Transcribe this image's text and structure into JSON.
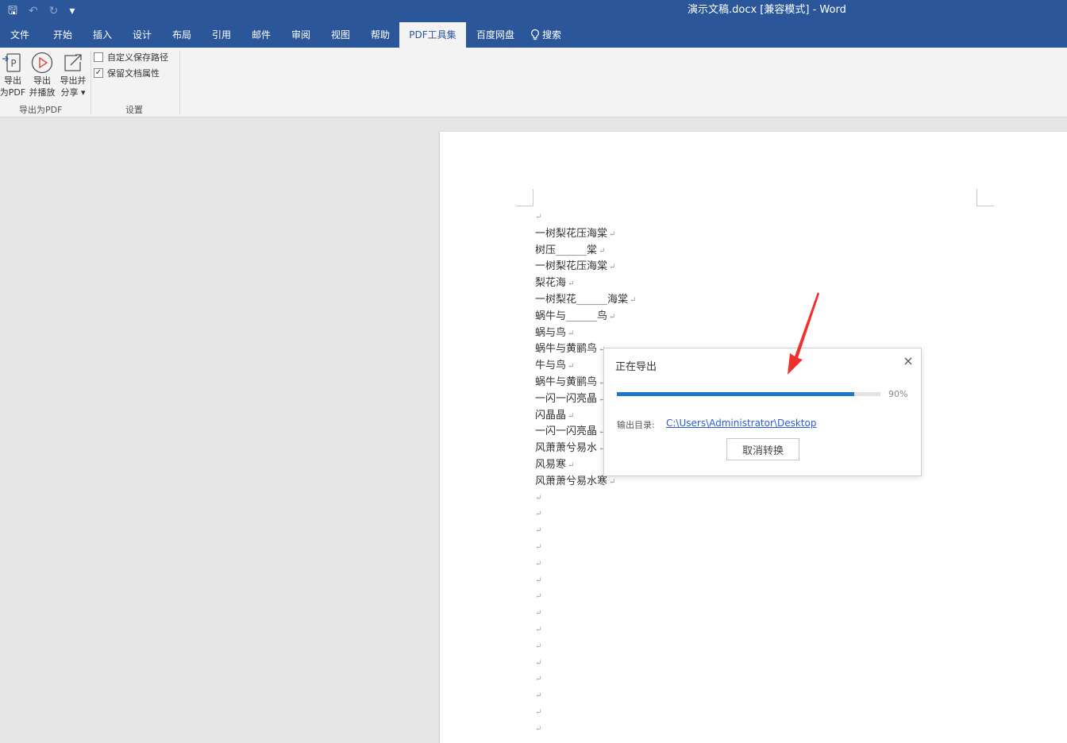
{
  "window": {
    "title": "演示文稿.docx [兼容模式] - Word",
    "qat": {
      "save_glyph": "🖫",
      "undo_glyph": "↶",
      "redo_glyph": "↻",
      "customize_glyph": "▾"
    }
  },
  "ribbon_tabs": [
    {
      "label": "文件"
    },
    {
      "label": "开始"
    },
    {
      "label": "插入"
    },
    {
      "label": "设计"
    },
    {
      "label": "布局"
    },
    {
      "label": "引用"
    },
    {
      "label": "邮件"
    },
    {
      "label": "审阅"
    },
    {
      "label": "视图"
    },
    {
      "label": "帮助"
    },
    {
      "label": "PDF工具集"
    },
    {
      "label": "百度网盘"
    }
  ],
  "search_tab": {
    "label": "搜索"
  },
  "ribbon": {
    "export_pdf": {
      "line1": "导出",
      "line2": "为PDF"
    },
    "export_play": {
      "line1": "导出",
      "line2": "并播放"
    },
    "export_share": {
      "line1": "导出并",
      "line2": "分享 ▾"
    },
    "group_export_label": "导出为PDF",
    "custom_path": {
      "label": "自定义保存路径",
      "checked": false
    },
    "keep_props": {
      "label": "保留文档属性",
      "checked": true,
      "check_glyph": "✓"
    },
    "group_settings_label": "设置"
  },
  "document": {
    "lines": [
      "一树梨花压海棠",
      "树压______棠",
      "一树梨花压海棠",
      "梨花海",
      "一树梨花______海棠",
      "蜗牛与______鸟",
      "蜗与鸟",
      "蜗牛与黄鹂鸟",
      "牛与鸟",
      "蜗牛与黄鹂鸟",
      "一闪一闪亮晶",
      "闪晶晶",
      "一闪一闪亮晶",
      "风萧萧兮易水",
      "风易寒",
      "风萧萧兮易水寒"
    ],
    "paragraph_mark": "↵"
  },
  "dialog": {
    "title": "正在导出",
    "close_glyph": "×",
    "progress_value": 0.9,
    "progress_text": "90%",
    "output_label": "输出目录:",
    "output_path": "C:\\Users\\Administrator\\Desktop",
    "cancel_label": "取消转换"
  },
  "colors": {
    "title_bar": "#2b579a",
    "progress": "#1e78c8",
    "link": "#2a5bd7",
    "arrow": "#f0302b"
  }
}
